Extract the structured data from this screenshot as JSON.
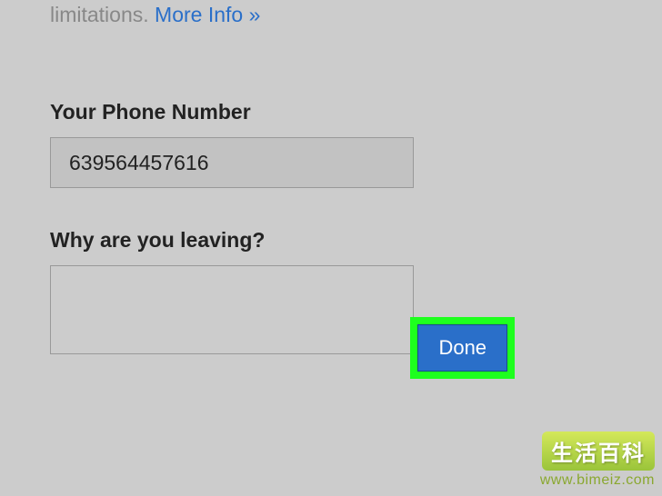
{
  "intro": {
    "prefix": "limitations. ",
    "more_info": "More Info »"
  },
  "phone": {
    "label": "Your Phone Number",
    "value": "639564457616"
  },
  "reason": {
    "label": "Why are you leaving?",
    "value": ""
  },
  "actions": {
    "done_label": "Done"
  },
  "watermark": {
    "title": "生活百科",
    "url": "www.bimeiz.com"
  }
}
